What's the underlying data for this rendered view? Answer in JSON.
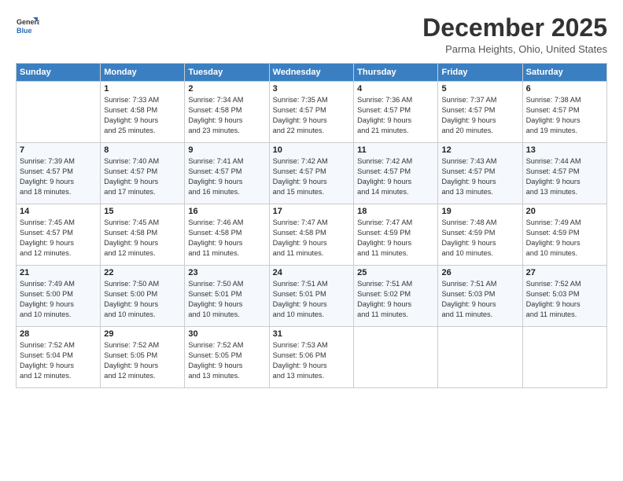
{
  "logo": {
    "general": "General",
    "blue": "Blue"
  },
  "title": "December 2025",
  "location": "Parma Heights, Ohio, United States",
  "days_of_week": [
    "Sunday",
    "Monday",
    "Tuesday",
    "Wednesday",
    "Thursday",
    "Friday",
    "Saturday"
  ],
  "weeks": [
    [
      {
        "day": "",
        "detail": ""
      },
      {
        "day": "1",
        "detail": "Sunrise: 7:33 AM\nSunset: 4:58 PM\nDaylight: 9 hours\nand 25 minutes."
      },
      {
        "day": "2",
        "detail": "Sunrise: 7:34 AM\nSunset: 4:58 PM\nDaylight: 9 hours\nand 23 minutes."
      },
      {
        "day": "3",
        "detail": "Sunrise: 7:35 AM\nSunset: 4:57 PM\nDaylight: 9 hours\nand 22 minutes."
      },
      {
        "day": "4",
        "detail": "Sunrise: 7:36 AM\nSunset: 4:57 PM\nDaylight: 9 hours\nand 21 minutes."
      },
      {
        "day": "5",
        "detail": "Sunrise: 7:37 AM\nSunset: 4:57 PM\nDaylight: 9 hours\nand 20 minutes."
      },
      {
        "day": "6",
        "detail": "Sunrise: 7:38 AM\nSunset: 4:57 PM\nDaylight: 9 hours\nand 19 minutes."
      }
    ],
    [
      {
        "day": "7",
        "detail": "Sunrise: 7:39 AM\nSunset: 4:57 PM\nDaylight: 9 hours\nand 18 minutes."
      },
      {
        "day": "8",
        "detail": "Sunrise: 7:40 AM\nSunset: 4:57 PM\nDaylight: 9 hours\nand 17 minutes."
      },
      {
        "day": "9",
        "detail": "Sunrise: 7:41 AM\nSunset: 4:57 PM\nDaylight: 9 hours\nand 16 minutes."
      },
      {
        "day": "10",
        "detail": "Sunrise: 7:42 AM\nSunset: 4:57 PM\nDaylight: 9 hours\nand 15 minutes."
      },
      {
        "day": "11",
        "detail": "Sunrise: 7:42 AM\nSunset: 4:57 PM\nDaylight: 9 hours\nand 14 minutes."
      },
      {
        "day": "12",
        "detail": "Sunrise: 7:43 AM\nSunset: 4:57 PM\nDaylight: 9 hours\nand 13 minutes."
      },
      {
        "day": "13",
        "detail": "Sunrise: 7:44 AM\nSunset: 4:57 PM\nDaylight: 9 hours\nand 13 minutes."
      }
    ],
    [
      {
        "day": "14",
        "detail": "Sunrise: 7:45 AM\nSunset: 4:57 PM\nDaylight: 9 hours\nand 12 minutes."
      },
      {
        "day": "15",
        "detail": "Sunrise: 7:45 AM\nSunset: 4:58 PM\nDaylight: 9 hours\nand 12 minutes."
      },
      {
        "day": "16",
        "detail": "Sunrise: 7:46 AM\nSunset: 4:58 PM\nDaylight: 9 hours\nand 11 minutes."
      },
      {
        "day": "17",
        "detail": "Sunrise: 7:47 AM\nSunset: 4:58 PM\nDaylight: 9 hours\nand 11 minutes."
      },
      {
        "day": "18",
        "detail": "Sunrise: 7:47 AM\nSunset: 4:59 PM\nDaylight: 9 hours\nand 11 minutes."
      },
      {
        "day": "19",
        "detail": "Sunrise: 7:48 AM\nSunset: 4:59 PM\nDaylight: 9 hours\nand 10 minutes."
      },
      {
        "day": "20",
        "detail": "Sunrise: 7:49 AM\nSunset: 4:59 PM\nDaylight: 9 hours\nand 10 minutes."
      }
    ],
    [
      {
        "day": "21",
        "detail": "Sunrise: 7:49 AM\nSunset: 5:00 PM\nDaylight: 9 hours\nand 10 minutes."
      },
      {
        "day": "22",
        "detail": "Sunrise: 7:50 AM\nSunset: 5:00 PM\nDaylight: 9 hours\nand 10 minutes."
      },
      {
        "day": "23",
        "detail": "Sunrise: 7:50 AM\nSunset: 5:01 PM\nDaylight: 9 hours\nand 10 minutes."
      },
      {
        "day": "24",
        "detail": "Sunrise: 7:51 AM\nSunset: 5:01 PM\nDaylight: 9 hours\nand 10 minutes."
      },
      {
        "day": "25",
        "detail": "Sunrise: 7:51 AM\nSunset: 5:02 PM\nDaylight: 9 hours\nand 11 minutes."
      },
      {
        "day": "26",
        "detail": "Sunrise: 7:51 AM\nSunset: 5:03 PM\nDaylight: 9 hours\nand 11 minutes."
      },
      {
        "day": "27",
        "detail": "Sunrise: 7:52 AM\nSunset: 5:03 PM\nDaylight: 9 hours\nand 11 minutes."
      }
    ],
    [
      {
        "day": "28",
        "detail": "Sunrise: 7:52 AM\nSunset: 5:04 PM\nDaylight: 9 hours\nand 12 minutes."
      },
      {
        "day": "29",
        "detail": "Sunrise: 7:52 AM\nSunset: 5:05 PM\nDaylight: 9 hours\nand 12 minutes."
      },
      {
        "day": "30",
        "detail": "Sunrise: 7:52 AM\nSunset: 5:05 PM\nDaylight: 9 hours\nand 13 minutes."
      },
      {
        "day": "31",
        "detail": "Sunrise: 7:53 AM\nSunset: 5:06 PM\nDaylight: 9 hours\nand 13 minutes."
      },
      {
        "day": "",
        "detail": ""
      },
      {
        "day": "",
        "detail": ""
      },
      {
        "day": "",
        "detail": ""
      }
    ]
  ]
}
